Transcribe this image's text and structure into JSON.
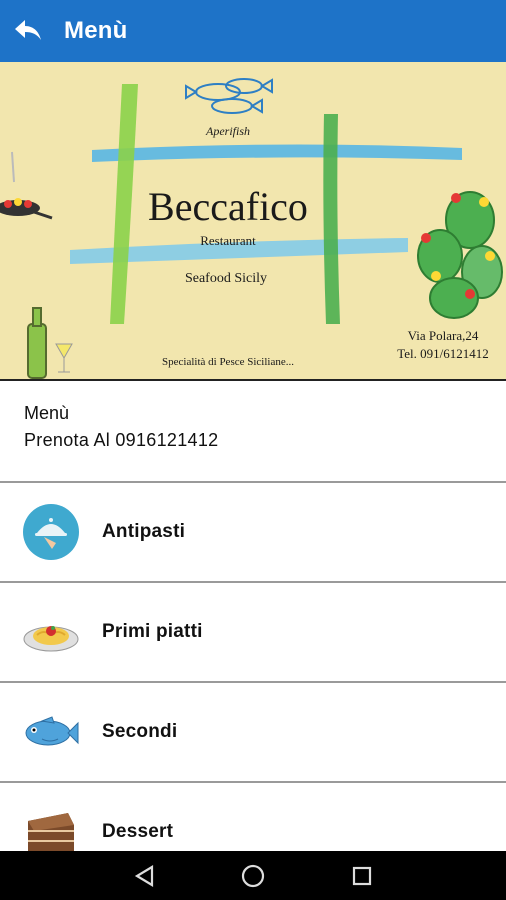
{
  "appbar": {
    "title": "Menù"
  },
  "banner": {
    "aperifish": "Aperifish",
    "name": "Beccafico",
    "restaurant": "Restaurant",
    "seafood": "Seafood Sicily",
    "specialita": "Specialità di Pesce Siciliane...",
    "address": "Via Polara,24",
    "tel": "Tel. 091/6121412"
  },
  "info": {
    "title": "Menù",
    "phone_text": "Prenota Al 0916121412"
  },
  "menu": {
    "items": [
      {
        "label": "Antipasti",
        "icon": "cloche-icon"
      },
      {
        "label": "Primi piatti",
        "icon": "pasta-icon"
      },
      {
        "label": "Secondi",
        "icon": "fish-icon"
      },
      {
        "label": "Dessert",
        "icon": "cake-icon"
      }
    ]
  },
  "colors": {
    "appbar": "#1E73C8",
    "banner_bg": "#F2E6AE",
    "navbar": "#000000"
  }
}
